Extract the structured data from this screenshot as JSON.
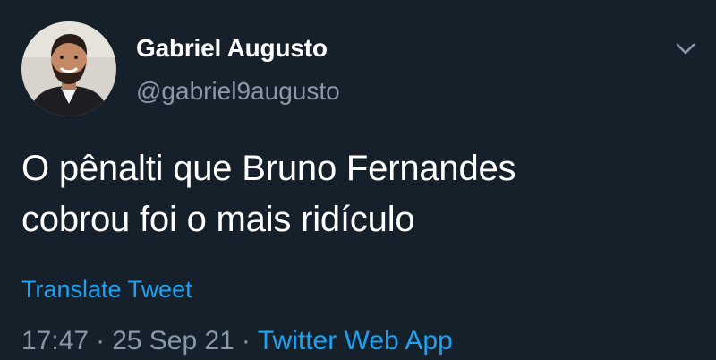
{
  "tweet": {
    "author": {
      "display_name": "Gabriel Augusto",
      "handle": "@gabriel9augusto"
    },
    "text_lines": [
      "O pênalti que Bruno Fernandes",
      "cobrou foi o mais ridículo"
    ],
    "translate_label": "Translate Tweet",
    "time": "17:47",
    "date": "25 Sep 21",
    "separator": "·",
    "source": "Twitter Web App"
  },
  "icons": {
    "menu": "chevron-down-icon"
  },
  "colors": {
    "background": "#15202b",
    "primary_text": "#ffffff",
    "secondary_text": "#8899a6",
    "accent": "#1da1f2"
  }
}
